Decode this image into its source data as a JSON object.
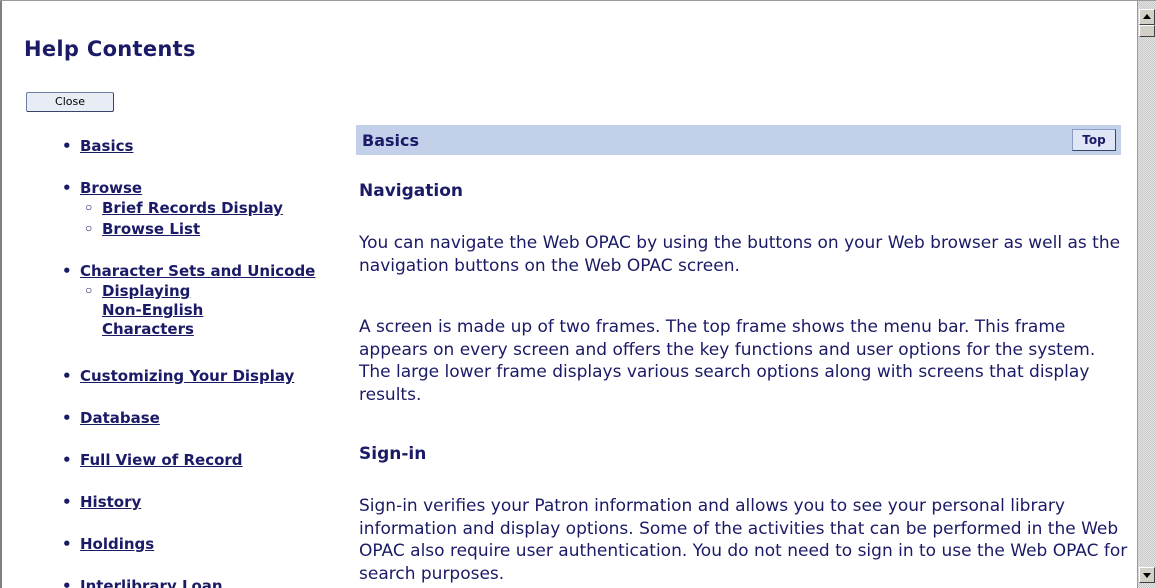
{
  "header": {
    "title": "Help Contents",
    "close_label": "Close"
  },
  "toc": {
    "basics": "Basics",
    "browse": "Browse",
    "browse_sub": [
      "Brief Records Display",
      "Browse List"
    ],
    "charsets": "Character Sets and Unicode",
    "charsets_sub": [
      "Displaying",
      "Non-English",
      "Characters"
    ],
    "customizing": "Customizing Your Display",
    "database": "Database",
    "full_view": "Full View of Record",
    "history": "History",
    "holdings": "Holdings",
    "ill": "Interlibrary Loan"
  },
  "main": {
    "section_title": "Basics",
    "top_label": "Top",
    "nav_heading": "Navigation",
    "nav_p1": "You can navigate the Web OPAC by using the buttons on your Web browser as well as the navigation buttons on the Web OPAC screen.",
    "nav_p2": "A screen is made up of two frames. The top frame shows the menu bar. This frame appears on every screen and offers the key functions and user options for the system. The large lower frame displays various search options along with screens that display results.",
    "signin_heading": "Sign-in",
    "signin_p1": "Sign-in verifies your Patron information and allows you to see your personal library information and display options. Some of the activities that can be performed in the Web OPAC also require user authentication. You do not need to sign in to use the Web OPAC for search purposes."
  },
  "colors": {
    "text": "#1a1a66",
    "section_bar": "#c3d0ea"
  }
}
